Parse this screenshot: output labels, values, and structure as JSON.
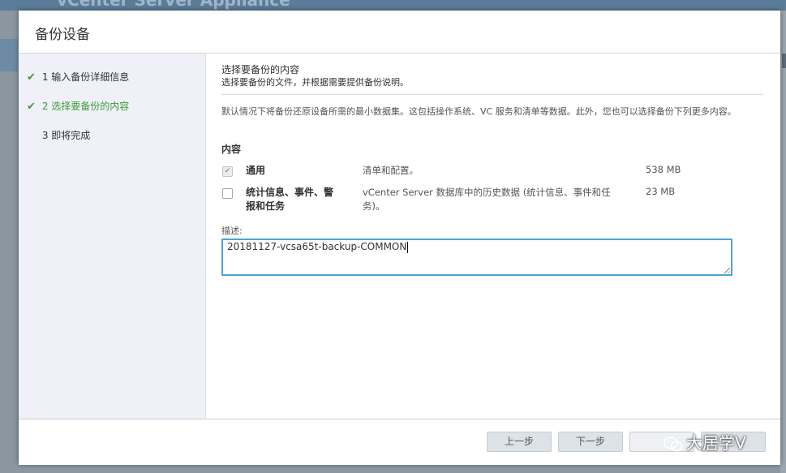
{
  "background": {
    "app_title": "vCenter Server Appliance"
  },
  "dialog": {
    "title": "备份设备"
  },
  "steps": [
    {
      "number": "1",
      "label": "输入备份详细信息",
      "state": "done"
    },
    {
      "number": "2",
      "label": "选择要备份的内容",
      "state": "active"
    },
    {
      "number": "3",
      "label": "即将完成",
      "state": "pending"
    }
  ],
  "content": {
    "section_title": "选择要备份的内容",
    "section_subtitle": "选择要备份的文件，并根据需要提供备份说明。",
    "description": "默认情况下将备份还原设备所需的最小数据集。这包括操作系统、VC 服务和清单等数据。此外，您也可以选择备份下列更多内容。",
    "contents_label": "内容",
    "items": [
      {
        "name": "通用",
        "info": "清单和配置。",
        "size": "538 MB",
        "checked": true,
        "disabled": true
      },
      {
        "name": "统计信息、事件、警报和任务",
        "info": "vCenter Server 数据库中的历史数据 (统计信息、事件和任务)。",
        "size": "23 MB",
        "checked": false,
        "disabled": false
      }
    ],
    "desc_label": "描述:",
    "desc_value": "20181127-vcsa65t-backup-COMMON"
  },
  "footer": {
    "back_label": "上一步",
    "next_label": "下一步",
    "watermark_text": "大居学V"
  },
  "colors": {
    "accent_green": "#3d9a39",
    "focus_blue": "#4da3d7"
  }
}
